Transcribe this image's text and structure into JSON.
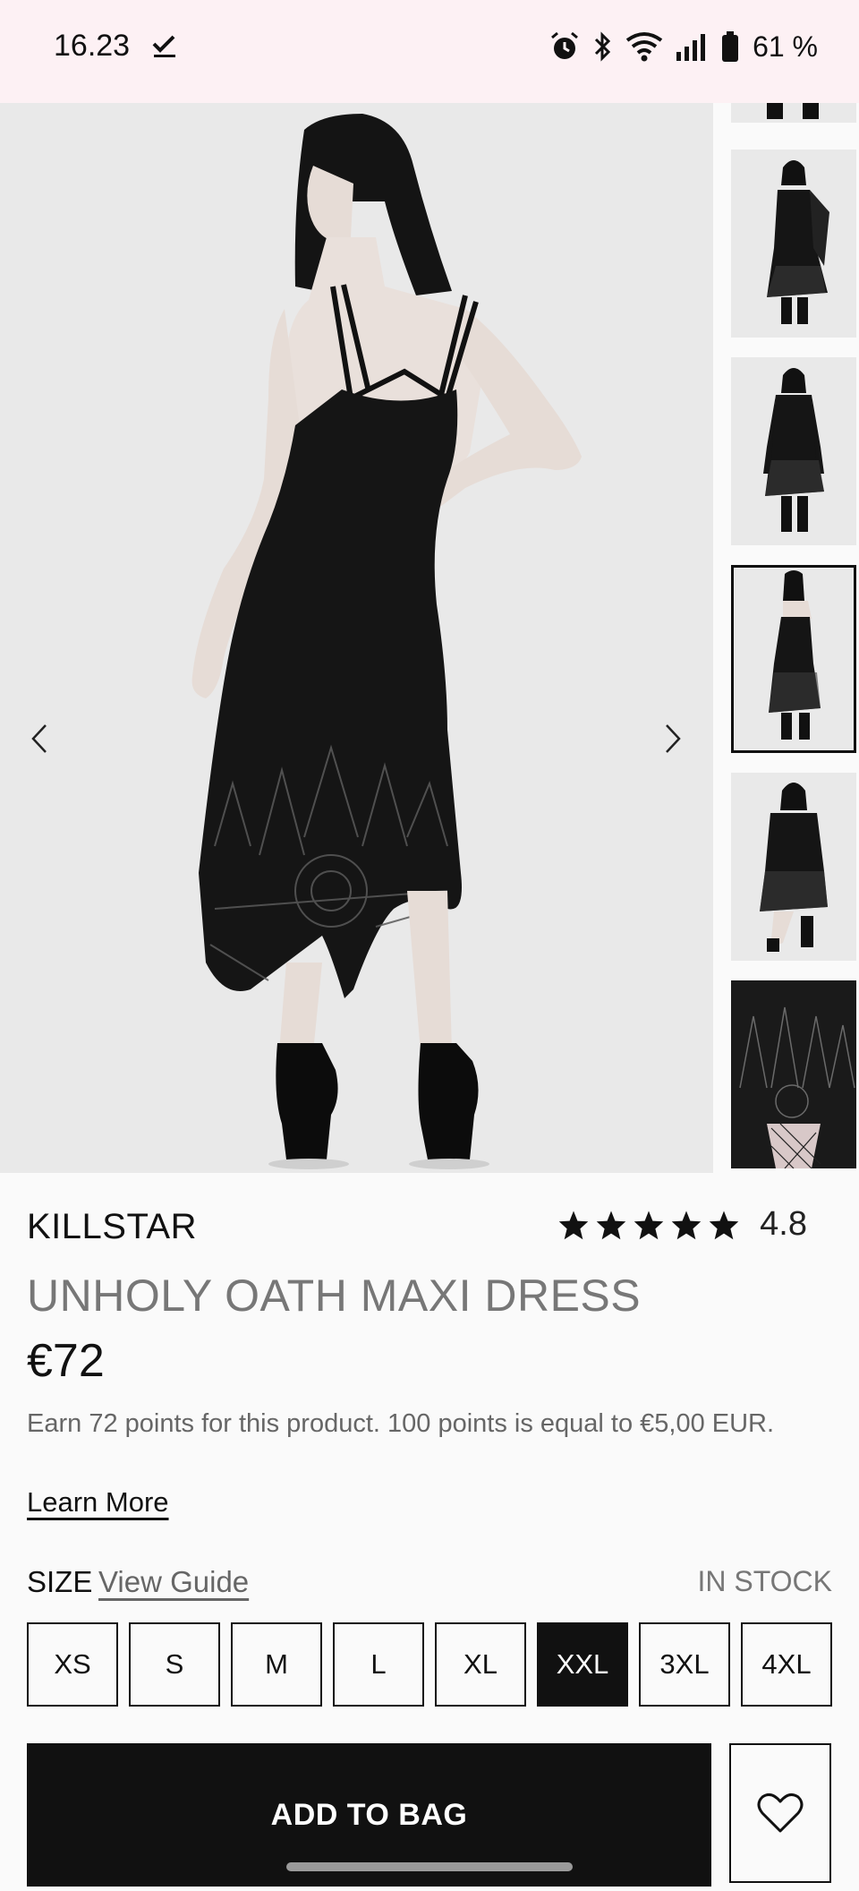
{
  "status_bar": {
    "time": "16.23",
    "battery": "61 %"
  },
  "gallery": {
    "main_image_alt": "model wearing dress, back view",
    "prev_icon": "chevron-left-icon",
    "next_icon": "chevron-right-icon",
    "thumbnails": [
      {
        "name": "thumb-boots-partial"
      },
      {
        "name": "thumb-front-with-cardigan"
      },
      {
        "name": "thumb-front-long-sleeve"
      },
      {
        "name": "thumb-back-view",
        "selected": true
      },
      {
        "name": "thumb-front-plus-size"
      },
      {
        "name": "thumb-hem-detail"
      }
    ]
  },
  "product": {
    "brand": "KILLSTAR",
    "rating": "4.8",
    "rating_stars": 5,
    "title": "UNHOLY OATH MAXI DRESS",
    "price": "€72",
    "points_text": "Earn 72 points for this product. 100 points is equal to €5,00 EUR.",
    "learn_more": "Learn More"
  },
  "size_section": {
    "label": "SIZE",
    "guide_link": "View Guide",
    "stock_status": "IN STOCK",
    "options": [
      "XS",
      "S",
      "M",
      "L",
      "XL",
      "XXL",
      "3XL",
      "4XL"
    ],
    "selected": "XXL"
  },
  "actions": {
    "add_to_bag": "ADD TO BAG",
    "wishlist_icon": "heart-icon"
  }
}
